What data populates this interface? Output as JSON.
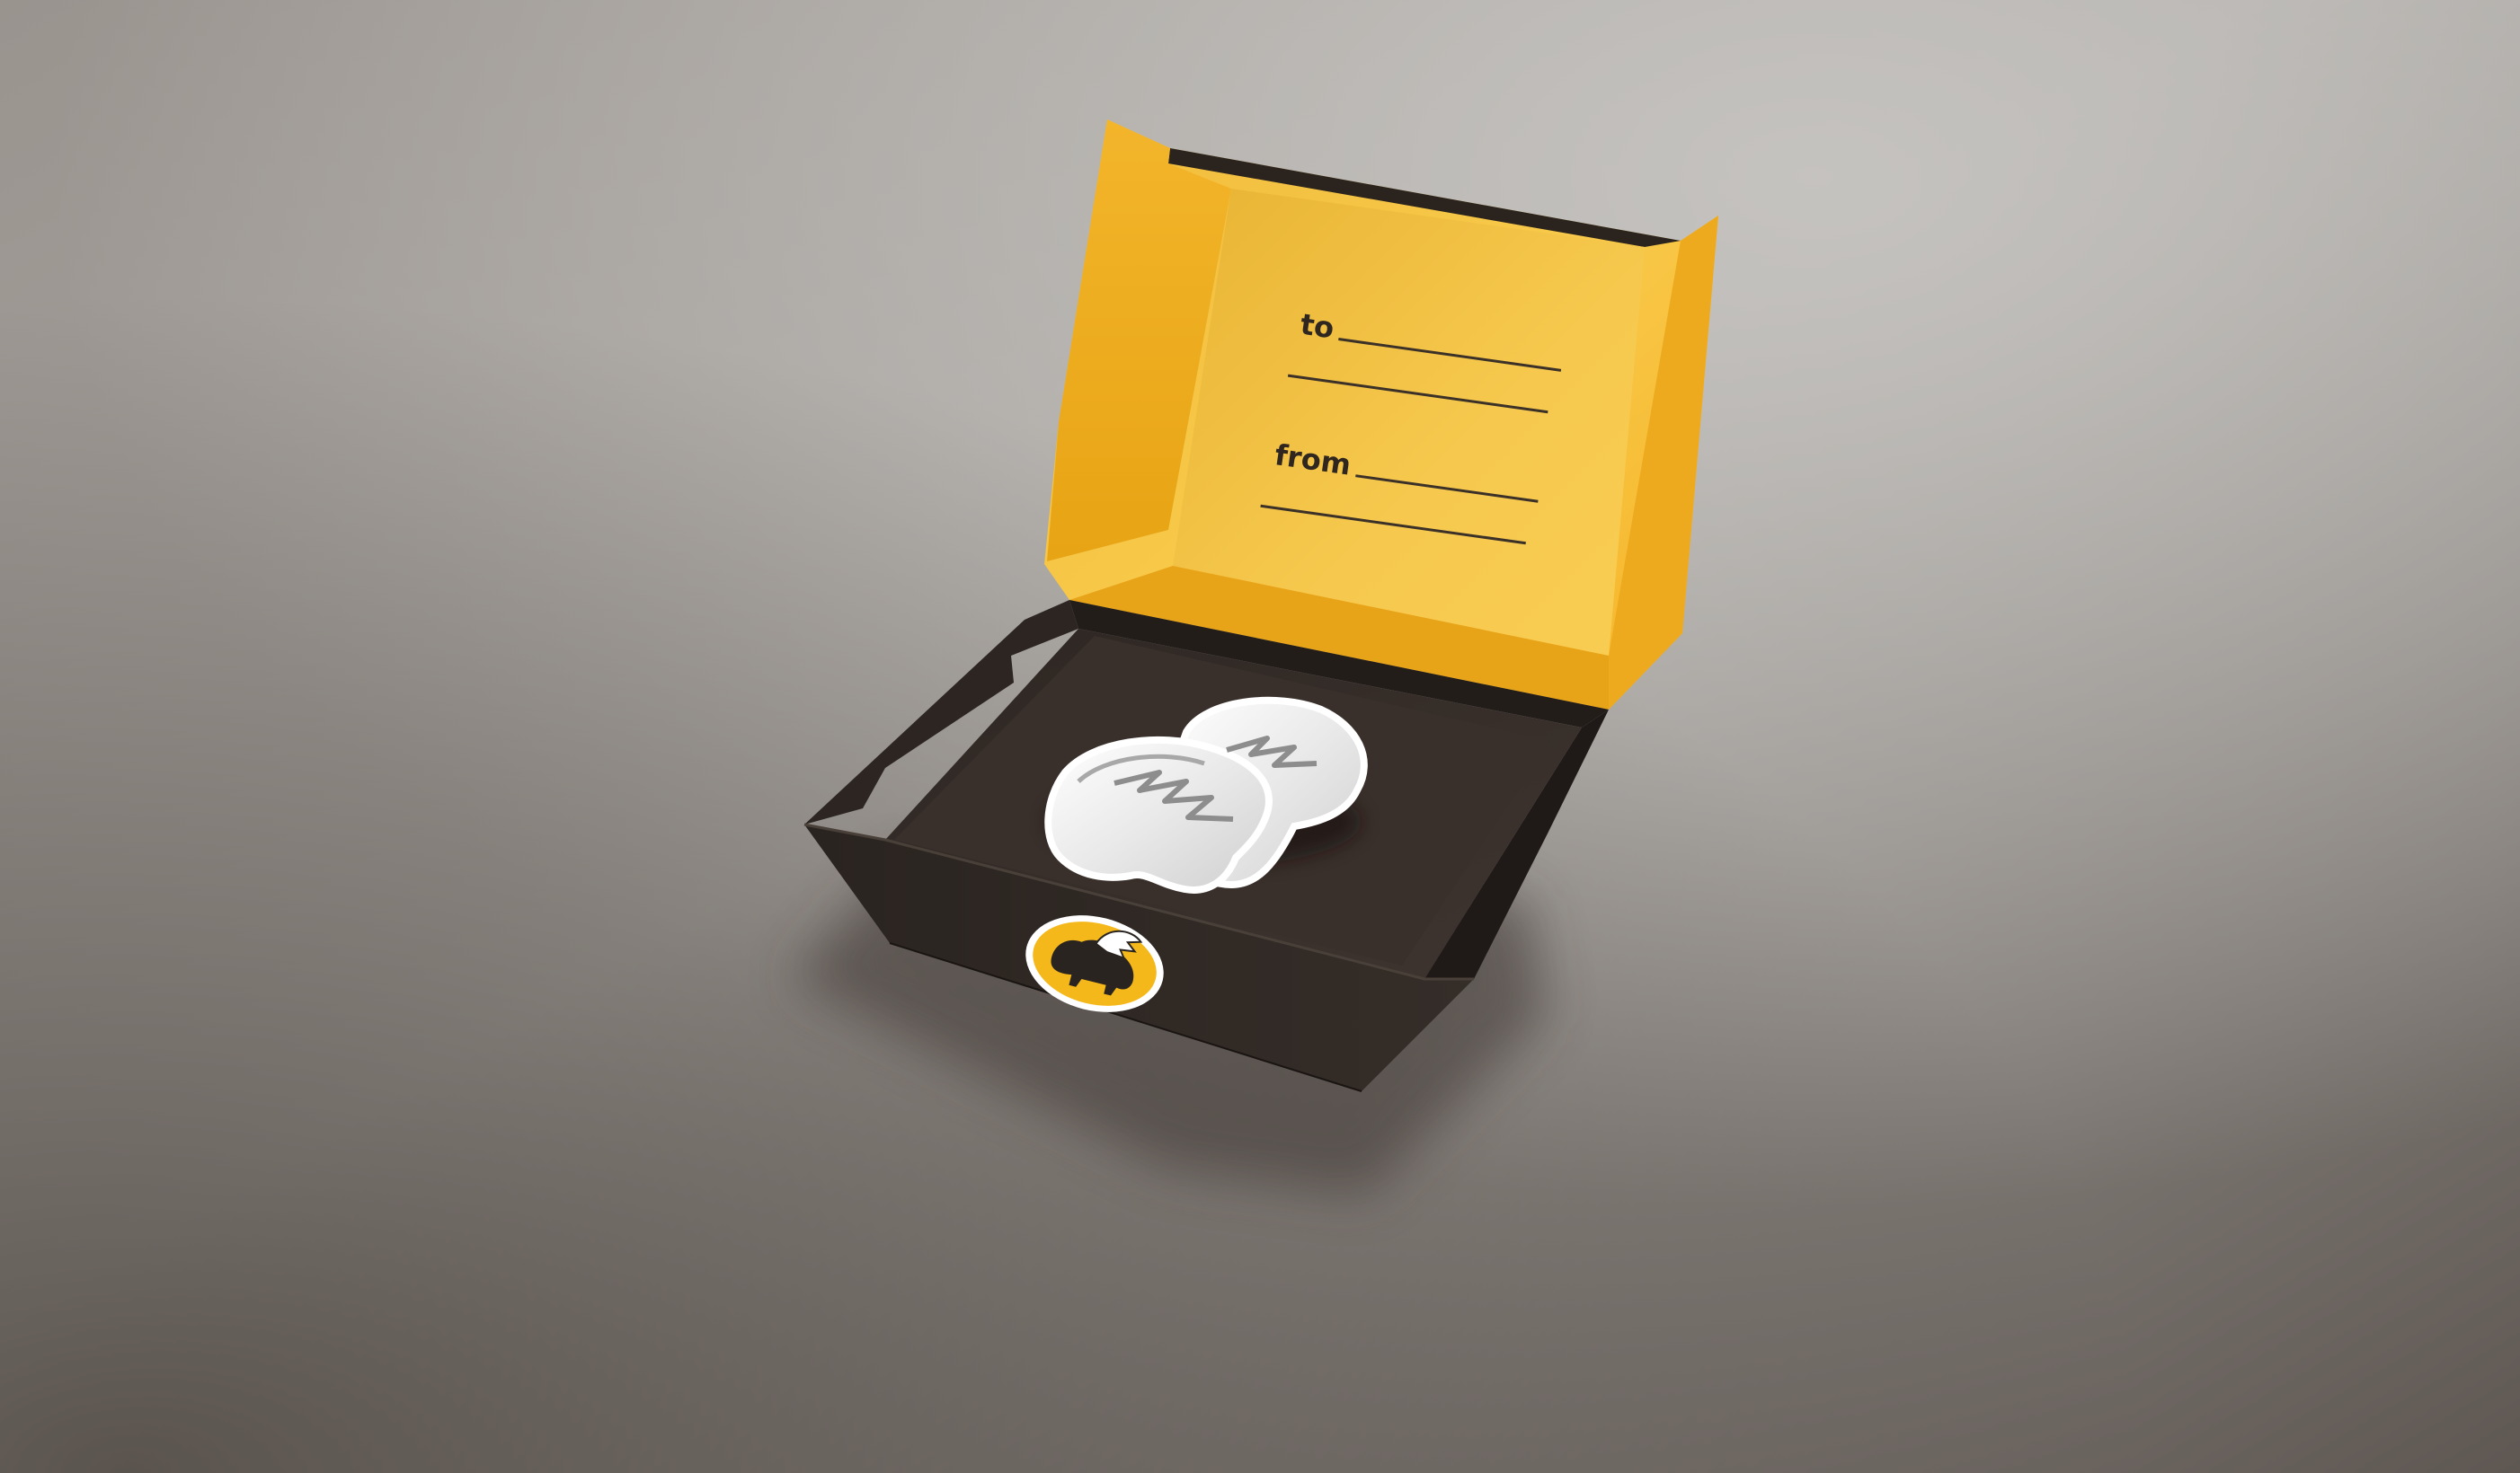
{
  "gift_tag": {
    "to_label": "to",
    "from_label": "from"
  },
  "colors": {
    "box_brown": "#2a2420",
    "box_inside": "#3b322d",
    "lid_yellow": "#f7c23a",
    "lid_yellow_deep": "#eea917",
    "tag_ink": "#2e261f",
    "emblem_yellow": "#f5b81a"
  },
  "icons": {
    "emblem": "winged-buffalo-emblem-icon",
    "card": "winged-buffalo-gift-card"
  }
}
